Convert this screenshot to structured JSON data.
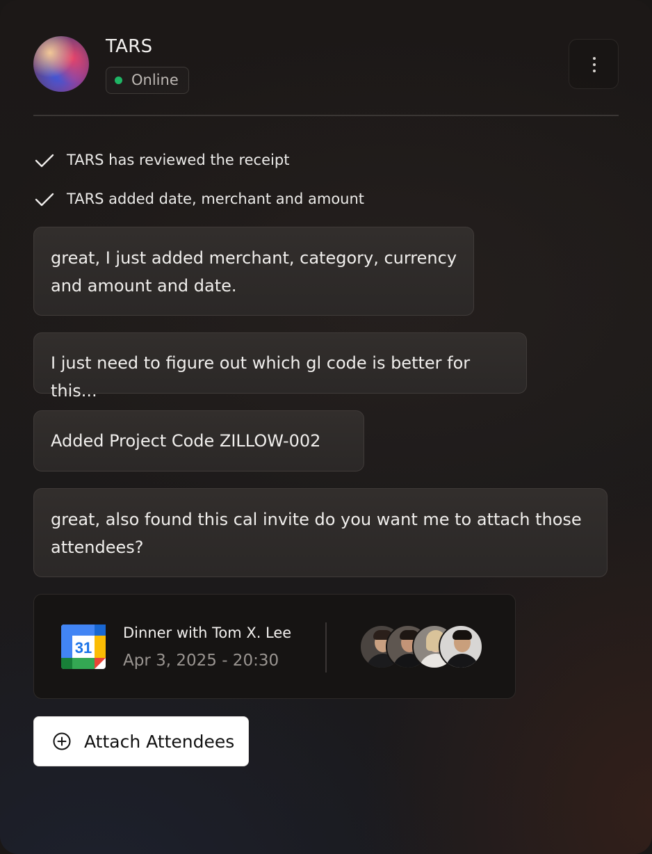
{
  "header": {
    "title": "TARS",
    "status": "Online",
    "status_color": "#1fb565"
  },
  "checks": [
    {
      "icon": "checkmark-icon",
      "text": "TARS has reviewed the receipt"
    },
    {
      "icon": "checkmark-icon",
      "text": "TARS added date, merchant and amount"
    }
  ],
  "messages": [
    {
      "lines": [
        "great, I just added merchant, category, currency",
        "and amount and date."
      ]
    },
    {
      "lines": [
        "I just need to figure out which gl code is better for this..."
      ]
    },
    {
      "lines": [
        "Added Project Code ZILLOW-002"
      ]
    },
    {
      "lines": [
        "great, also found this cal invite do you want me to attach those",
        "attendees?"
      ]
    }
  ],
  "calendar_event": {
    "icon": "google-calendar-icon",
    "icon_day": "31",
    "title": "Dinner with Tom X. Lee",
    "datetime": "Apr 3, 2025 - 20:30",
    "attendee_count": 4
  },
  "actions": {
    "attach_label": "Attach Attendees",
    "attach_icon": "plus-circle-icon"
  }
}
